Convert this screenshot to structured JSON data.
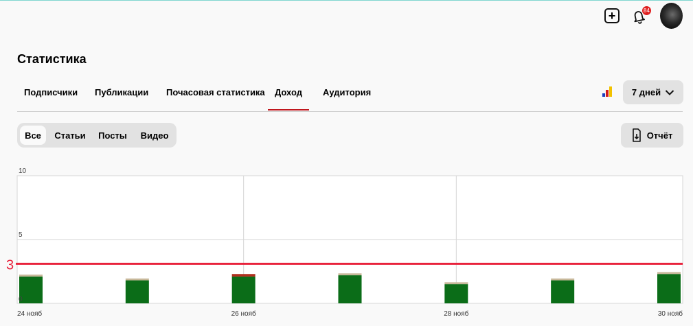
{
  "header": {
    "notification_count": "84",
    "add_icon": "plus-square-icon",
    "bell_icon": "bell-icon"
  },
  "page": {
    "title": "Статистика"
  },
  "tabs": [
    {
      "label": "Подписчики"
    },
    {
      "label": "Публикации"
    },
    {
      "label": "Почасовая статистика"
    },
    {
      "label": "Доход",
      "active": true
    },
    {
      "label": "Аудитория"
    }
  ],
  "period": {
    "label": "7 дней"
  },
  "filters": [
    {
      "label": "Все",
      "active": true
    },
    {
      "label": "Статьи"
    },
    {
      "label": "Посты"
    },
    {
      "label": "Видео"
    }
  ],
  "report": {
    "label": "Отчёт"
  },
  "colors": {
    "accent": "#c0171e",
    "bar": "#0b6d18",
    "bar_cap": "#c8b89a",
    "bar_cap_alt": "#b0301f",
    "threshold": "#e8223c"
  },
  "chart_data": {
    "type": "bar",
    "categories": [
      "24 нояб",
      "25 нояб",
      "26 нояб",
      "27 нояб",
      "28 нояб",
      "29 нояб",
      "30 нояб"
    ],
    "x_tick_labels": [
      "24 нояб",
      "26 нояб",
      "28 нояб",
      "30 нояб"
    ],
    "y_tick_labels": [
      "10",
      "5",
      "0"
    ],
    "ylim": [
      0,
      10
    ],
    "series": [
      {
        "values": [
          2.1,
          1.8,
          2.1,
          2.2,
          1.5,
          1.8,
          2.3
        ]
      },
      {
        "values": [
          0.15,
          0.15,
          0.2,
          0.15,
          0.15,
          0.15,
          0.15
        ]
      }
    ],
    "threshold": {
      "value": 3.1,
      "label": "3"
    },
    "grid": true
  }
}
